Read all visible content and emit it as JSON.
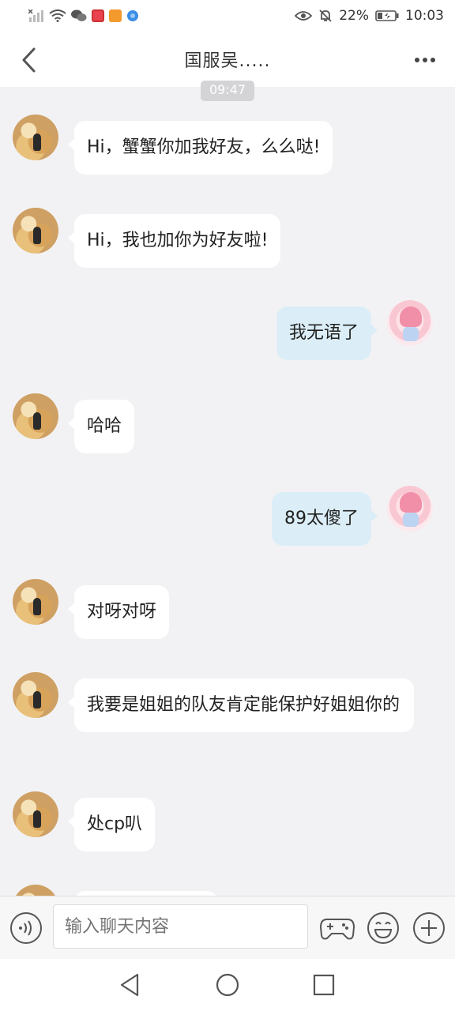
{
  "status_bar": {
    "battery": "22%",
    "time": "10:03",
    "wechat_color": "#555555",
    "app1_color": "#e8434f",
    "app2_color": "#f39a2c",
    "app3_color": "#3a8ee6"
  },
  "header": {
    "title": "国服吴....."
  },
  "time_chip": "09:47",
  "messages": [
    {
      "side": "other",
      "text": "Hi，蟹蟹你加我好友，么么哒!"
    },
    {
      "side": "other",
      "text": "Hi，我也加你为好友啦!"
    },
    {
      "side": "self",
      "text": "我无语了"
    },
    {
      "side": "other",
      "text": "哈哈"
    },
    {
      "side": "self",
      "text": "89太傻了"
    },
    {
      "side": "other",
      "text": "对呀对呀"
    },
    {
      "side": "other",
      "text": "我要是姐姐的队友肯定能保护好姐姐你的"
    },
    {
      "side": "other",
      "text": "处cp叭"
    },
    {
      "side": "other",
      "text": ""
    }
  ],
  "input_bar": {
    "placeholder": "输入聊天内容"
  },
  "colors": {
    "background": "#f2f2f4",
    "self_bubble": "#dbeef8",
    "other_bubble": "#ffffff"
  },
  "icons": {
    "back": "chevron-left-icon",
    "more": "more-dots-icon",
    "voice": "voice-icon",
    "game": "gamepad-icon",
    "emoji": "emoji-icon",
    "plus": "plus-icon"
  }
}
